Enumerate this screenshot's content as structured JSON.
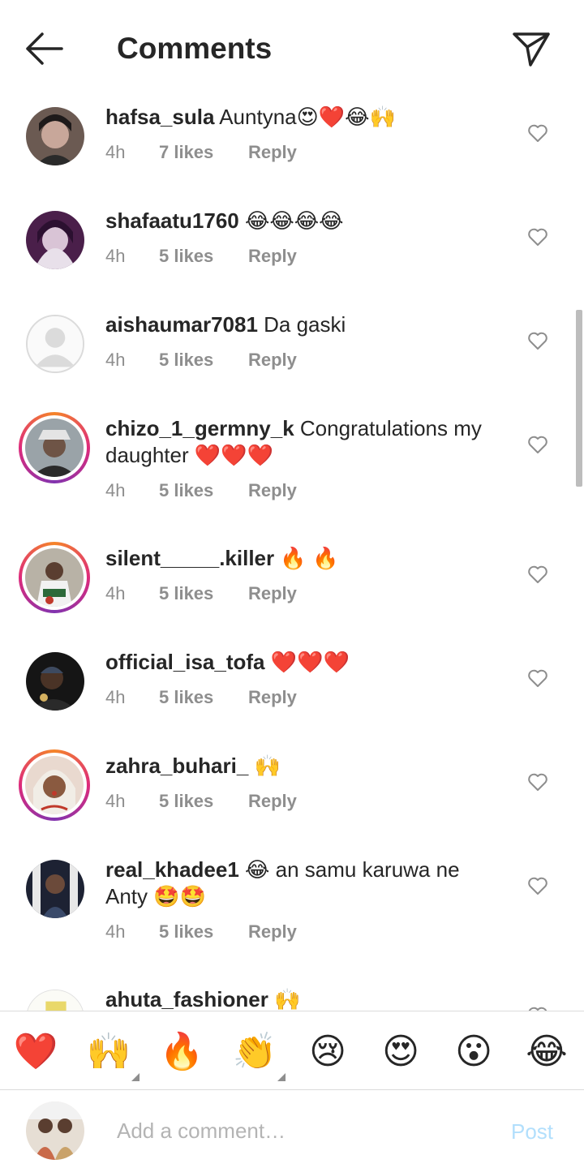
{
  "header": {
    "title": "Comments"
  },
  "comments": [
    {
      "username": "hafsa_sula",
      "text": "Auntyna😍❤️😂🙌",
      "time": "4h",
      "likes": "7 likes",
      "reply": "Reply"
    },
    {
      "username": "shafaatu1760",
      "text": "😂😂😂😂",
      "time": "4h",
      "likes": "5 likes",
      "reply": "Reply"
    },
    {
      "username": "aishaumar7081",
      "text": "Da gaski",
      "time": "4h",
      "likes": "5 likes",
      "reply": "Reply"
    },
    {
      "username": "chizo_1_germny_k",
      "text": "Congratulations my daughter ❤️❤️❤️",
      "time": "4h",
      "likes": "5 likes",
      "reply": "Reply"
    },
    {
      "username": "silent_____.killer",
      "text": "🔥 🔥",
      "time": "4h",
      "likes": "5 likes",
      "reply": "Reply"
    },
    {
      "username": "official_isa_tofa",
      "text": "❤️❤️❤️",
      "time": "4h",
      "likes": "5 likes",
      "reply": "Reply"
    },
    {
      "username": "zahra_buhari_",
      "text": "🙌",
      "time": "4h",
      "likes": "5 likes",
      "reply": "Reply"
    },
    {
      "username": "real_khadee1",
      "text": "😂 an samu karuwa ne Anty 🤩🤩",
      "time": "4h",
      "likes": "5 likes",
      "reply": "Reply"
    },
    {
      "username": "ahuta_fashioner",
      "text": "🙌",
      "time": "",
      "likes": "",
      "reply": ""
    }
  ],
  "quick_reactions": [
    "❤️",
    "🙌",
    "🔥",
    "👏",
    "😢",
    "😍",
    "😮",
    "😂"
  ],
  "composer": {
    "placeholder": "Add a comment…",
    "post_label": "Post"
  },
  "colors": {
    "story_ring": "#dd2a7b",
    "post_disabled": "#b2dffc",
    "meta_text": "#8e8e8e"
  }
}
